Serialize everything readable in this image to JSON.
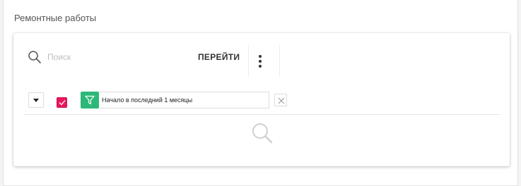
{
  "section": {
    "title": "Ремонтные работы"
  },
  "toolbar": {
    "search_placeholder": "Поиск",
    "search_value": "",
    "go_label": "ПЕРЕЙТИ",
    "more_icon": "more-vertical-icon"
  },
  "filter": {
    "dropdown_icon": "caret-down-icon",
    "enabled": true,
    "icon": "funnel-icon",
    "text": "Начало в последний 1 месяцы",
    "remove_icon": "close-icon"
  },
  "empty_state": {
    "icon": "search-icon"
  },
  "colors": {
    "checkbox": "#e8175d",
    "filter_icon_bg": "#2db87a"
  }
}
